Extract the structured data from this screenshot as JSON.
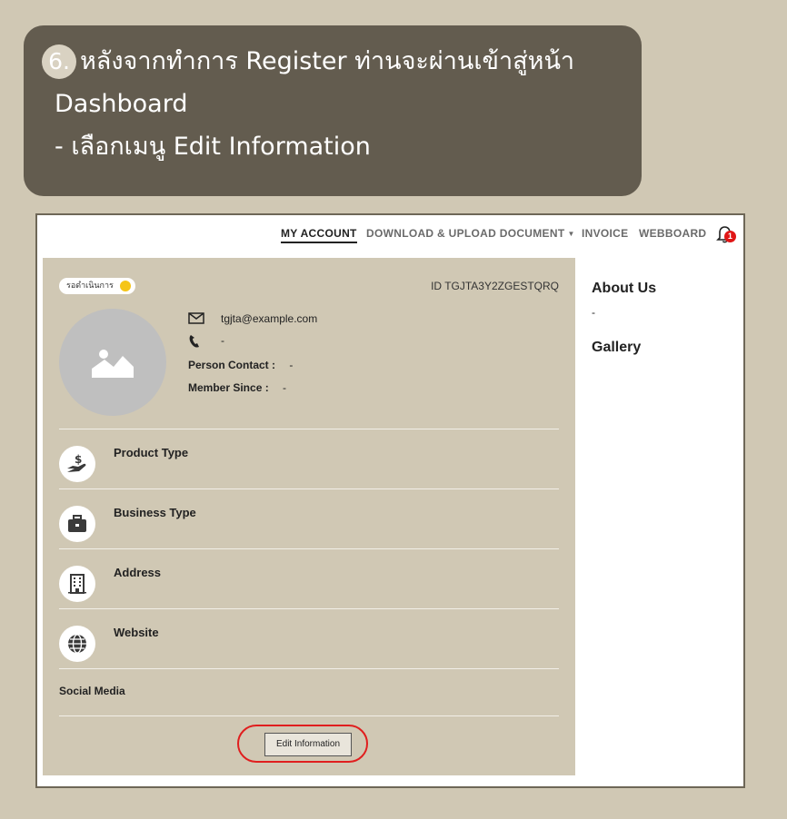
{
  "banner": {
    "step_number": "6.",
    "line1": "หลังจากทำการ Register ท่านจะผ่านเข้าสู่หน้า",
    "line2": "Dashboard",
    "line3": "- เลือกเมนู Edit Information"
  },
  "nav": {
    "my_account": "MY ACCOUNT",
    "download_upload": "DOWNLOAD & UPLOAD DOCUMENT",
    "invoice": "INVOICE",
    "webboard": "WEBBOARD",
    "notification_count": "1"
  },
  "profile": {
    "status": "รอดำเนินการ",
    "member_id": "ID TGJTA3Y2ZGESTQRQ",
    "email": "tgjta@example.com",
    "phone": "-",
    "person_contact_label": "Person Contact :",
    "person_contact_value": "-",
    "member_since_label": "Member Since :",
    "member_since_value": "-"
  },
  "sections": {
    "product_type": "Product Type",
    "business_type": "Business Type",
    "address": "Address",
    "website": "Website",
    "social_media": "Social Media"
  },
  "actions": {
    "edit_information": "Edit Information"
  },
  "sidebar": {
    "about_us_title": "About Us",
    "about_us_value": "-",
    "gallery_title": "Gallery"
  },
  "colors": {
    "banner_bg": "#635c4f",
    "page_bg": "#d0c8b4",
    "status_dot": "#f5c518",
    "highlight": "#e01e1e"
  }
}
